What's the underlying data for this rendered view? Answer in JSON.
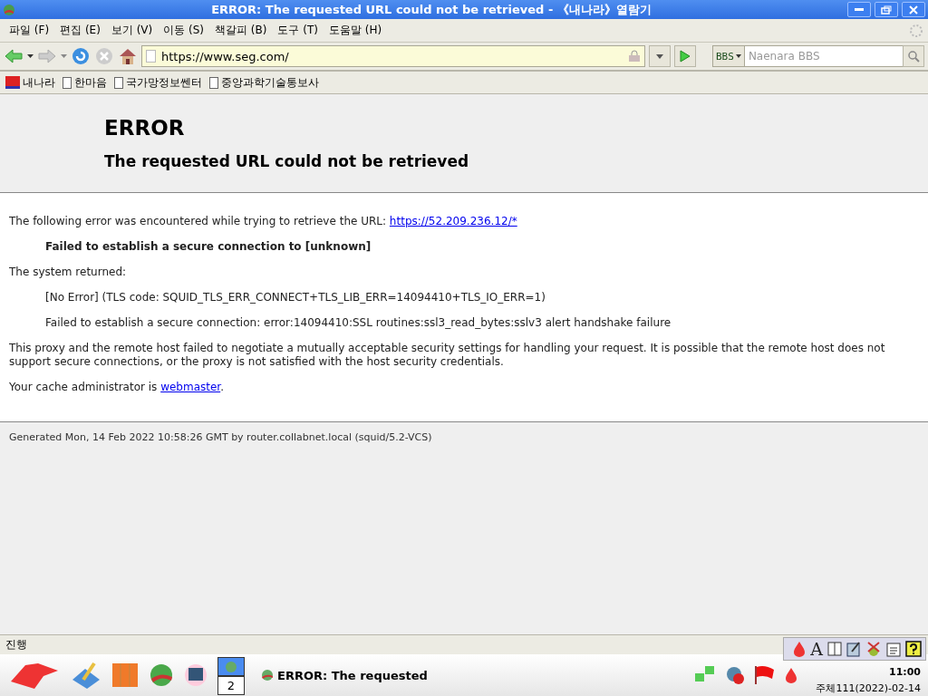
{
  "window": {
    "title": "ERROR: The requested URL could not be retrieved - 《내나라》열람기"
  },
  "menu": [
    "파일 (F)",
    "편집 (E)",
    "보기 (V)",
    "이동 (S)",
    "책갈피 (B)",
    "도구 (T)",
    "도움말 (H)"
  ],
  "nav": {
    "url": "https://www.seg.com/",
    "search_engine": "BBS",
    "search_placeholder": "Naenara BBS",
    "back_disabled": false,
    "forward_disabled": true,
    "stop_disabled": true
  },
  "bookmarks": [
    {
      "label": "내나라",
      "kind": "logo"
    },
    {
      "label": "한마음",
      "kind": "page"
    },
    {
      "label": "국가망정보쎈터",
      "kind": "page"
    },
    {
      "label": "중앙과학기술통보사",
      "kind": "page"
    }
  ],
  "page": {
    "heading": "ERROR",
    "subheading": "The requested URL could not be retrieved",
    "intro": "The following error was encountered while trying to retrieve the URL:",
    "intro_link": "https://52.209.236.12/*",
    "error": "Failed to establish a secure connection to [unknown]",
    "system_returned": "The system returned:",
    "details": [
      "[No Error] (TLS code: SQUID_TLS_ERR_CONNECT+TLS_LIB_ERR=14094410+TLS_IO_ERR=1)",
      "Failed to establish a secure connection: error:14094410:SSL routines:ssl3_read_bytes:sslv3 alert handshake failure"
    ],
    "explanation": "This proxy and the remote host failed to negotiate a mutually acceptable security settings for handling your request. It is possible that the remote host does not support secure connections, or the proxy is not satisfied with the host security credentials.",
    "admin_text": "Your cache administrator is",
    "admin_link": "webmaster",
    "admin_end": ".",
    "footer": "Generated Mon, 14 Feb 2022 10:58:26 GMT by router.collabnet.local (squid/5.2-VCS)"
  },
  "status_bar": {
    "text": "진행"
  },
  "taskbar": {
    "desktops": [
      {
        "label": "2",
        "selected": false
      }
    ],
    "task": "ERROR: The requested",
    "clock": "11:00",
    "date": "주체111(2022)-02-14",
    "ime_font_label": "A"
  }
}
